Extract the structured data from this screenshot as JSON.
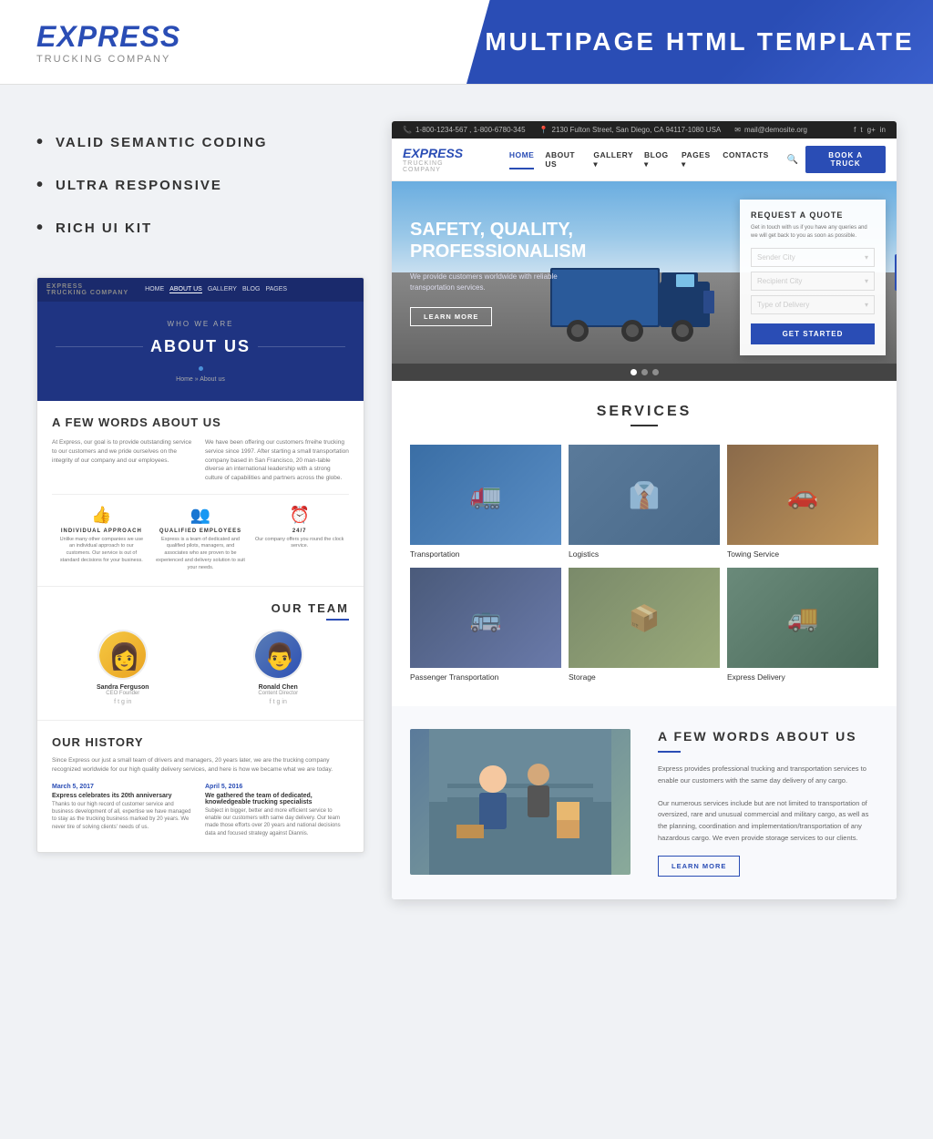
{
  "header": {
    "logo_express": "EXPRESS",
    "logo_sub": "TRUCKING COMPANY",
    "template_title": "MULTIPAGE HTML TEMPLATE"
  },
  "features": {
    "items": [
      "VALID SEMANTIC CODING",
      "ULTRA RESPONSIVE",
      "RICH UI KIT"
    ]
  },
  "about_preview": {
    "nav": {
      "logo": "EXPRESS",
      "logo_sub": "TRUCKING COMPANY",
      "links": [
        "HOME",
        "ABOUT US",
        "GALLERY",
        "BLOG",
        "PAGES"
      ]
    },
    "hero": {
      "who": "WHO WE ARE",
      "title": "ABOUT US",
      "breadcrumb": "Home  »  About us"
    },
    "body_title": "A FEW WORDS ABOUT US",
    "col1": "At Express, our goal is to provide outstanding service to our customers and we pride ourselves on the integrity of our company and our employees.",
    "col2": "We have been offering our customers frreihe trucking service since 1997. After starting a small transportation company based in San Francisco, 20 man-table diverse an international leadership with a strong culture of capabilities and partners across the globe.",
    "icons": [
      {
        "icon": "👍",
        "label": "INDIVIDUAL APPROACH",
        "desc": "Unlike many other companies we use an individual approach to our customers. Our service is out of standard decisions for your business."
      },
      {
        "icon": "👥",
        "label": "QUALIFIED EMPLOYEES",
        "desc": "Express is a team of dedicated and qualified pilots, managers, and associates who are proven to be experienced and delivery solution to suit your needs."
      },
      {
        "icon": "⏰",
        "label": "24/7",
        "desc": "Our company offers you round the clock service."
      }
    ],
    "team_title": "OUR TEAM",
    "team_members": [
      {
        "name": "Sandra Ferguson",
        "role": "CEO Founder"
      },
      {
        "name": "Ronald Chen",
        "role": "Content Director"
      }
    ],
    "history_title": "OUR HISTORY",
    "history_intro": "Since Express our just a small team of drivers and managers, 20 years later, we are the trucking company recognized worldwide for our high quality delivery services, and here is how we became what we are today.",
    "history_items": [
      {
        "date": "March 5, 2017",
        "event": "Express celebrates its 20th anniversary",
        "desc": "Thanks to our high record of customer service and business development of all, expertise we have managed to stay as the trucking business marked by 20 years. We never tire of solving clients' needs of us."
      },
      {
        "date": "April 5, 2016",
        "event": "We gathered the team of dedicated, knowledgeable trucking specialists",
        "desc": "Subject in bigger, better and more efficient service to enable our customers with same day delivery. Our team made those efforts over 20 years and national decisions data and focused strategy against Diannis."
      }
    ]
  },
  "site_preview": {
    "topbar": {
      "phone1": "1-800-1234-567",
      "phone2": "1-800-6780-345",
      "address": "2130 Fulton Street, San Diego, CA 94117-1080 USA",
      "email": "mail@demosite.org"
    },
    "nav": {
      "logo": "EXPRESS",
      "logo_sub": "TRUCKING COMPANY",
      "links": [
        "HOME",
        "ABOUT US",
        "GALLERY ▾",
        "BLOG ▾",
        "PAGES ▾",
        "CONTACTS"
      ],
      "active": "HOME",
      "book_btn": "BOOK A TRUCK"
    },
    "hero": {
      "title": "SAFETY, QUALITY,\nPROFESSIONALISM",
      "subtitle": "We provide customers worldwide with reliable transportation services.",
      "learn_more": "LEARN MORE",
      "quote_title": "REQUEST A QUOTE",
      "quote_desc": "Get in touch with us if you have any queries and we will get back to you as soon as possible.",
      "sender_city": "Sender City",
      "recipient_city": "Recipient City",
      "delivery_type": "Type of Delivery",
      "get_started": "GET STARTED"
    },
    "services": {
      "title": "SERVICES",
      "items": [
        {
          "label": "Transportation",
          "img_class": "service-img-transport"
        },
        {
          "label": "Logistics",
          "img_class": "service-img-logistics"
        },
        {
          "label": "Towing Service",
          "img_class": "service-img-towing"
        },
        {
          "label": "Passenger Transportation",
          "img_class": "service-img-passenger"
        },
        {
          "label": "Storage",
          "img_class": "service-img-storage"
        },
        {
          "label": "Express Delivery",
          "img_class": "service-img-delivery"
        }
      ]
    },
    "about_section": {
      "title": "A FEW WORDS ABOUT US",
      "text1": "Express provides professional trucking and transportation services to enable our customers with the same day delivery of any cargo.",
      "text2": "Our numerous services include but are not limited to transportation of oversized, rare and unusual commercial and military cargo, as well as the planning, coordination and implementation/transportation of any hazardous cargo. We even provide storage services to our clients.",
      "learn_more": "LEARN MORE"
    }
  }
}
